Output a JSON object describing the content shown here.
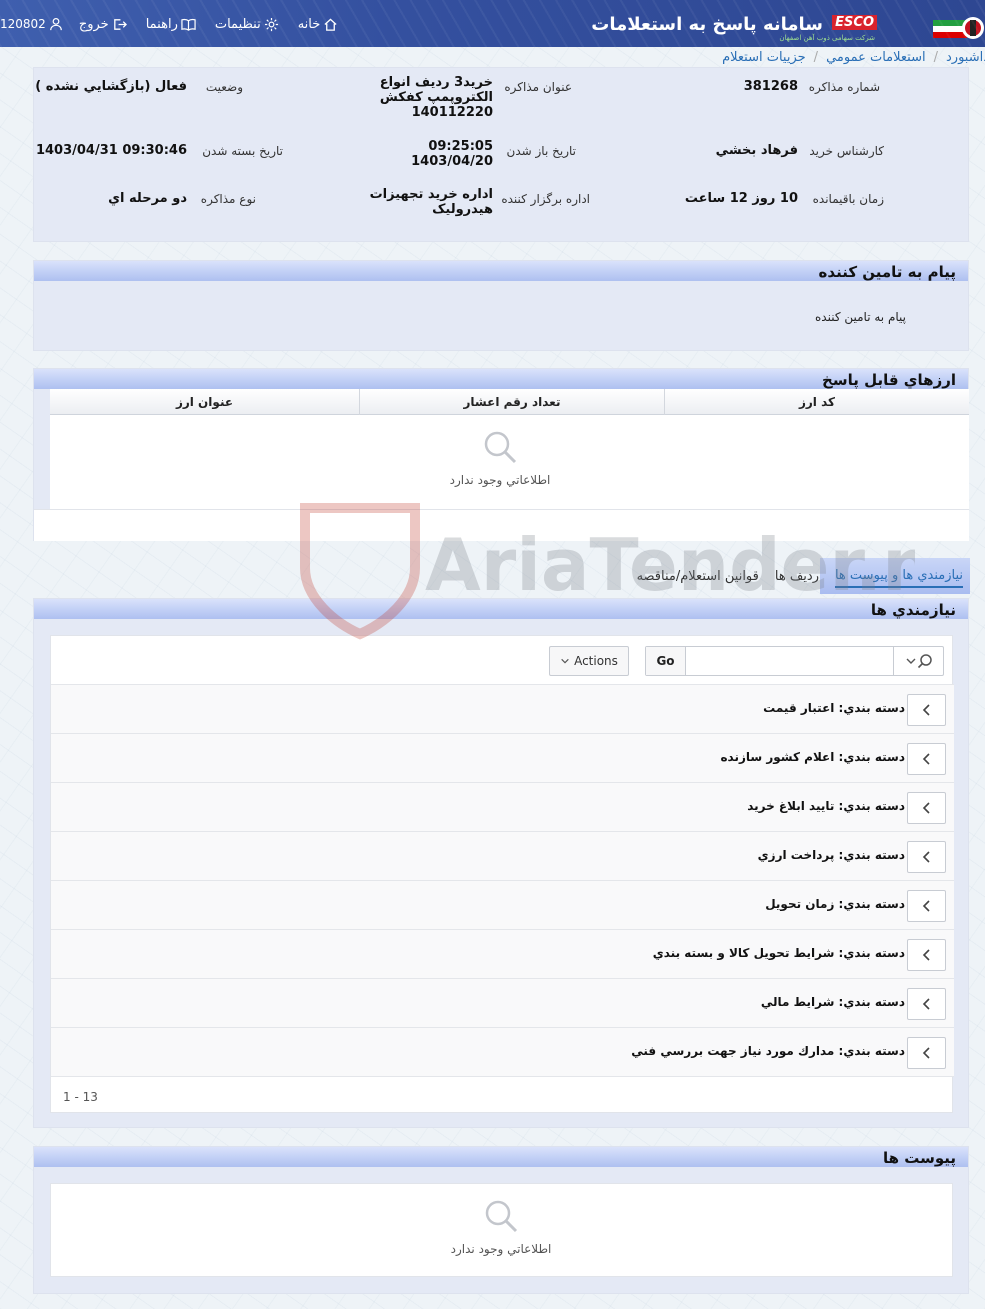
{
  "header": {
    "app_title": "سامانه پاسخ به استعلامات",
    "brand": "ESCO",
    "brand_sub": "شرکت سهامی ذوب آهن اصفهان",
    "nav": {
      "home": "خانه",
      "settings": "تنظيمات",
      "help": "راهنما",
      "logout": "خروج",
      "user_id": "120802"
    }
  },
  "breadcrumb": [
    "داشبورد",
    "استعلامات عمومي",
    "جزييات استعلام"
  ],
  "info": {
    "negotiation_number_label": "شماره مذاکره",
    "negotiation_number": "381268",
    "title_label": "عنوان مذاکره",
    "title_value": [
      "خريد3 رديف انواع",
      "الکتروپمپ کفکش",
      "140112220"
    ],
    "status_label": "وضعيت",
    "status_value": "فعال (بازگشايي نشده )",
    "buyer_expert_label": "کارشناس خريد",
    "buyer_expert": "فرهاد بخشي",
    "open_date_label": "تاريخ باز شدن",
    "open_date": [
      "09:25:05",
      "1403/04/20"
    ],
    "close_date_label": "تاريخ بسته شدن",
    "close_date": "1403/04/31 09:30:46",
    "remaining_label": "زمان باقيمانده",
    "remaining": "10 روز 12 ساعت",
    "organizer_label": "اداره برگزار کننده",
    "organizer": [
      "اداره خريد تجهيزات",
      "هيدروليک"
    ],
    "type_label": "نوع مذاکره",
    "type_value": "دو مرحله اي"
  },
  "message_panel": {
    "title": "پيام به تامين کننده",
    "text": "پيام به تامين کننده"
  },
  "currency_panel": {
    "title": "ارزهاي قابل پاسخ",
    "columns": [
      "کد ارز",
      "تعداد رقم اعشار",
      "عنوان ارز"
    ],
    "empty_text": "اطلاعاتي وجود ندارد"
  },
  "tabs": [
    "نيازمندي ها و پيوست ها",
    "رديف ها",
    "قوانين استعلام/مناقصه"
  ],
  "requirements_panel": {
    "title": "نيازمندي ها",
    "go_label": "Go",
    "actions_label": "Actions",
    "groups": [
      "دسته بندي: اعتبار قيمت",
      "دسته بندي: اعلام کشور سازنده",
      "دسته بندي: تاييد ابلاغ خريد",
      "دسته بندي: پرداخت ارزي",
      "دسته بندي: زمان تحويل",
      "دسته بندي: شرايط تحويل کالا و بسته بندي",
      "دسته بندي: شرايط مالي",
      "دسته بندي: مدارك مورد نياز جهت بررسي فني"
    ],
    "pagination": "1 - 13"
  },
  "attachments_panel": {
    "title": "پيوست ها",
    "empty_text": "اطلاعاتي وجود ندارد"
  },
  "watermark": "AriaTender.neT",
  "colors": {
    "header_bg": "#34509f",
    "panel_head": "#c3d1f6",
    "link": "#2a6fb6",
    "brand_red": "#d9232d"
  }
}
